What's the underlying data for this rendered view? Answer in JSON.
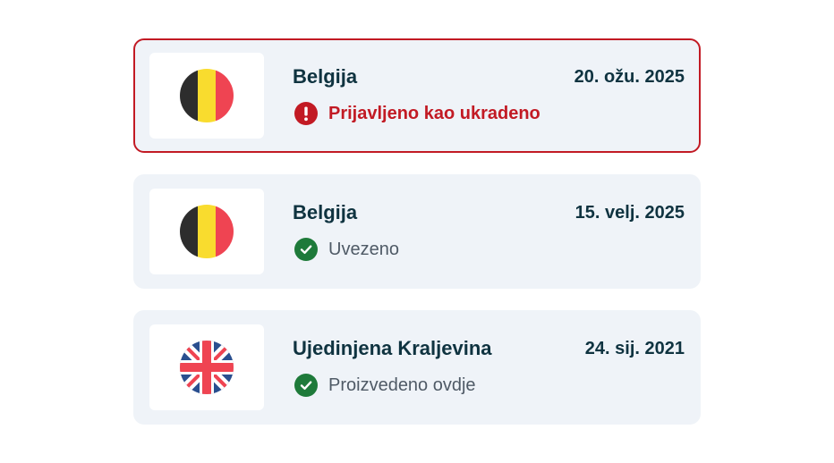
{
  "colors": {
    "alert": "#c21a24",
    "success": "#1e7a3a",
    "card_bg": "#eff3f8",
    "text_dark": "#0f3340",
    "text_muted": "#4f5a66"
  },
  "history": [
    {
      "country": "Belgija",
      "flag_icon": "belgium-flag-icon",
      "date": "20. ožu. 2025",
      "status": "Prijavljeno kao ukradeno",
      "status_icon": "alert-icon",
      "alert": true
    },
    {
      "country": "Belgija",
      "flag_icon": "belgium-flag-icon",
      "date": "15. velj. 2025",
      "status": "Uvezeno",
      "status_icon": "check-circle-icon",
      "alert": false
    },
    {
      "country": "Ujedinjena Kraljevina",
      "flag_icon": "uk-flag-icon",
      "date": "24. sij. 2021",
      "status": "Proizvedeno ovdje",
      "status_icon": "check-circle-icon",
      "alert": false
    }
  ]
}
